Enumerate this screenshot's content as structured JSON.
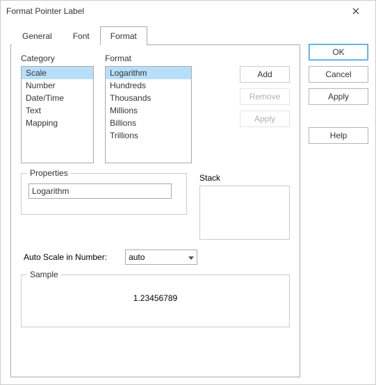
{
  "window": {
    "title": "Format Pointer Label"
  },
  "tabs": [
    {
      "label": "General",
      "active": false
    },
    {
      "label": "Font",
      "active": false
    },
    {
      "label": "Format",
      "active": true
    }
  ],
  "category": {
    "label": "Category",
    "items": [
      "Scale",
      "Number",
      "Date/Time",
      "Text",
      "Mapping"
    ],
    "selected": "Scale"
  },
  "format": {
    "label": "Format",
    "items": [
      "Logarithm",
      "Hundreds",
      "Thousands",
      "Millions",
      "Billions",
      "Trillions"
    ],
    "selected": "Logarithm"
  },
  "format_buttons": {
    "add": "Add",
    "remove": "Remove",
    "apply": "Apply",
    "remove_enabled": false,
    "apply_enabled": false
  },
  "properties": {
    "label": "Properties",
    "value": "Logarithm"
  },
  "stack": {
    "label": "Stack"
  },
  "auto_scale": {
    "label": "Auto Scale in Number:",
    "value": "auto"
  },
  "sample": {
    "label": "Sample",
    "value": "1.23456789"
  },
  "dialog_buttons": {
    "ok": "OK",
    "cancel": "Cancel",
    "apply": "Apply",
    "help": "Help"
  }
}
